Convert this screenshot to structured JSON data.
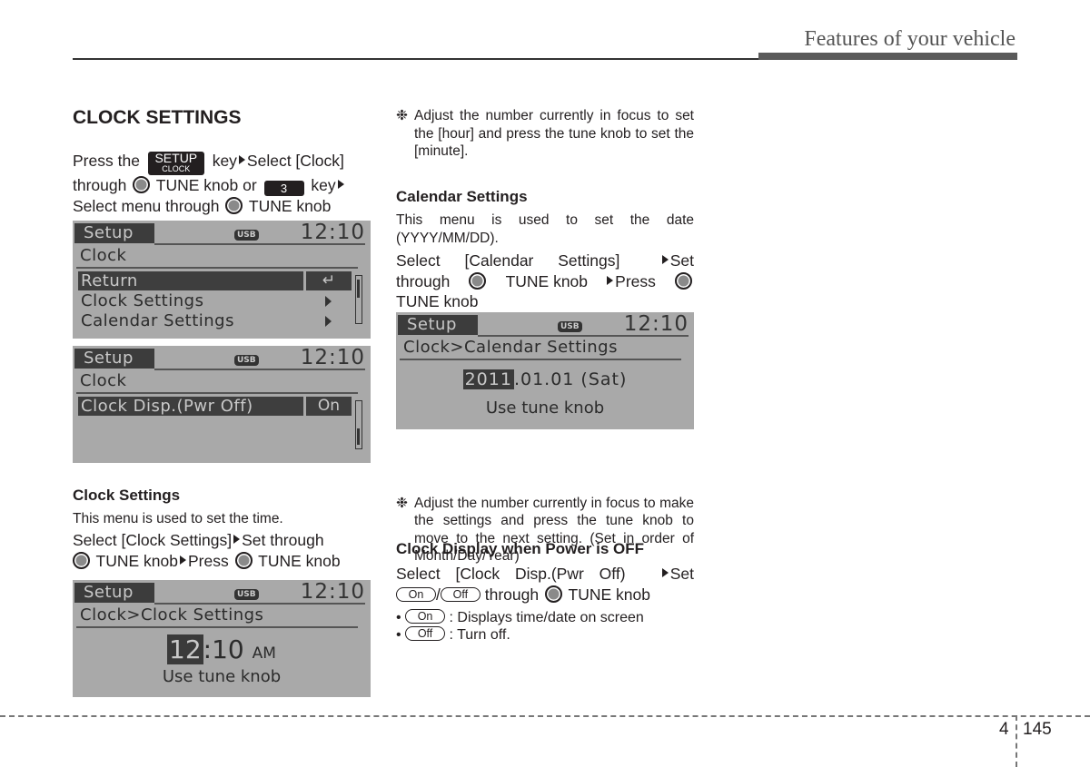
{
  "header": {
    "section_title": "Features of your vehicle"
  },
  "footer": {
    "chapter": "4",
    "page": "145"
  },
  "left": {
    "title": "CLOCK SETTINGS",
    "intro": {
      "press_the": "Press the",
      "setup_key_top": "SETUP",
      "setup_key_bottom": "CLOCK",
      "key_select_clock": "key",
      "select_clock": "Select [Clock]",
      "through": "through",
      "tune_knob_or": "TUNE knob or",
      "key3": "3",
      "key": "key",
      "select_menu_through": "Select menu through",
      "tune_knob": "TUNE knob"
    },
    "screen1": {
      "tab": "Setup",
      "usb": "USB",
      "time": "12:10",
      "crumb": "Clock",
      "rows": [
        {
          "label": "Return",
          "right": "↵"
        },
        {
          "label": "Clock Settings"
        },
        {
          "label": "Calendar Settings"
        }
      ]
    },
    "screen2": {
      "tab": "Setup",
      "usb": "USB",
      "time": "12:10",
      "crumb": "Clock",
      "rows": [
        {
          "label": "Clock Disp.(Pwr Off)",
          "value": "On"
        }
      ]
    },
    "clock_settings": {
      "title": "Clock Settings",
      "desc": "This menu is used to set the time.",
      "instr_1": "Select [Clock Settings]",
      "instr_2": "Set through",
      "instr_3": "TUNE knob",
      "instr_4": "Press",
      "instr_5": "TUNE knob"
    },
    "screen3": {
      "tab": "Setup",
      "usb": "USB",
      "time": "12:10",
      "crumb": "Clock>Clock Settings",
      "hour": "12",
      "sep": ":",
      "minute": "10",
      "ampm": "AM",
      "hint": "Use tune knob"
    }
  },
  "right": {
    "note1": {
      "mark": "❉",
      "text": "Adjust the number currently in focus to set the [hour] and press the tune knob to set the [minute]."
    },
    "calendar": {
      "title": "Calendar Settings",
      "desc": "This menu is used to set the date (YYYY/MM/DD).",
      "instr_1": "Select [Calendar Settings]",
      "instr_2": "Set",
      "instr_3": "through",
      "instr_4": "TUNE knob",
      "instr_5": "Press",
      "instr_6": "TUNE knob"
    },
    "screen4": {
      "tab": "Setup",
      "usb": "USB",
      "time": "12:10",
      "crumb": "Clock>Calendar Settings",
      "year": "2011",
      "rest": ".01.01 (Sat)",
      "hint": "Use tune knob"
    },
    "note2": {
      "mark": "❉",
      "text": "Adjust the number currently in focus to make the settings and press the tune knob to move to the next setting. (Set in order of Month/Day/Year)"
    },
    "clock_display": {
      "title": "Clock Display when Power is OFF",
      "instr_1": "Select [Clock Disp.(Pwr Off)",
      "instr_2": "Set",
      "on": "On",
      "slash": "/",
      "off": "Off",
      "instr_3": "through",
      "instr_4": "TUNE knob",
      "bullets": [
        {
          "pill": "On",
          "text": ": Displays time/date on screen"
        },
        {
          "pill": "Off",
          "text": ": Turn off."
        }
      ]
    }
  }
}
